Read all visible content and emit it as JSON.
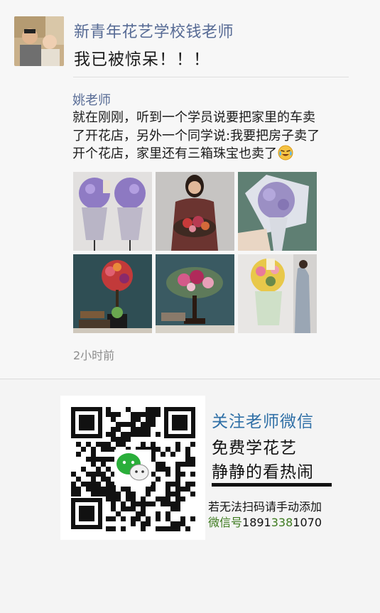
{
  "post": {
    "author": "新青年花艺学校钱老师",
    "status": "我已被惊呆！！！",
    "shared": {
      "author": "姚老师",
      "lines": [
        "就在刚刚，听到一个学员说要把家里的车卖",
        "了开花店，另外一个同学说:我要把房子卖了",
        "开个花店，家里还有三箱珠宝也卖了"
      ],
      "emoji": "crying-laugh-emoji"
    },
    "photos": [
      "purple-flower-stands",
      "woman-holding-flower-basket",
      "purple-hydrangea-bouquet",
      "red-rose-topiary",
      "pink-flower-arrangement",
      "flower-basket-stand"
    ],
    "time": "2小时前"
  },
  "promo": {
    "follow": "关注老师微信",
    "free": "免费学花艺",
    "watch": "静静的看热闹",
    "manual": "若无法扫码请手动添加",
    "wechat_label": "微信号",
    "wechat_number_a": "1891",
    "wechat_number_b": "338",
    "wechat_number_c": "1070"
  },
  "colors": {
    "link_blue": "#576b95",
    "promo_blue": "#2f6fa6",
    "wechat_green": "#3d7a1e"
  }
}
